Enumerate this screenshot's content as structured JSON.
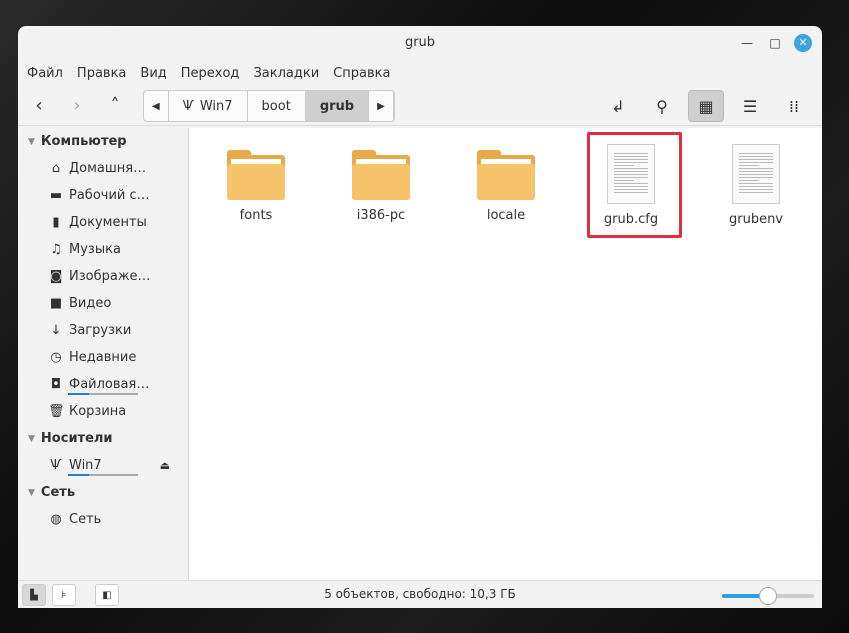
{
  "window": {
    "title": "grub"
  },
  "menu": [
    "Файл",
    "Правка",
    "Вид",
    "Переход",
    "Закладки",
    "Справка"
  ],
  "breadcrumb": [
    "Win7",
    "boot",
    "grub"
  ],
  "sidebar": {
    "sections": [
      {
        "title": "Компьютер",
        "items": [
          {
            "label": "Домашня…",
            "icon": "home-icon",
            "glyph": "⌂"
          },
          {
            "label": "Рабочий с…",
            "icon": "desktop-icon",
            "glyph": "▬"
          },
          {
            "label": "Документы",
            "icon": "document-icon",
            "glyph": "▮"
          },
          {
            "label": "Музыка",
            "icon": "music-icon",
            "glyph": "♫"
          },
          {
            "label": "Изображе…",
            "icon": "camera-icon",
            "glyph": "◙"
          },
          {
            "label": "Видео",
            "icon": "video-folder-icon",
            "glyph": "■"
          },
          {
            "label": "Загрузки",
            "icon": "download-icon",
            "glyph": "↓"
          },
          {
            "label": "Недавние",
            "icon": "clock-icon",
            "glyph": "◷"
          },
          {
            "label": "Файловая…",
            "icon": "filesystem-icon",
            "glyph": "◘",
            "usage": 0.3
          },
          {
            "label": "Корзина",
            "icon": "trash-icon",
            "glyph": "🗑"
          }
        ]
      },
      {
        "title": "Носители",
        "items": [
          {
            "label": "Win7",
            "icon": "usb-icon",
            "glyph": "Ѱ",
            "usage": 0.3,
            "eject": "⏏"
          }
        ]
      },
      {
        "title": "Сеть",
        "items": [
          {
            "label": "Сеть",
            "icon": "network-icon",
            "glyph": "◍"
          }
        ]
      }
    ]
  },
  "files": [
    {
      "name": "fonts",
      "type": "folder"
    },
    {
      "name": "i386-pc",
      "type": "folder"
    },
    {
      "name": "locale",
      "type": "folder"
    },
    {
      "name": "grub.cfg",
      "type": "text",
      "selected": true
    },
    {
      "name": "grubenv",
      "type": "text"
    }
  ],
  "status": {
    "text": "5 объектов, свободно: 10,3 ГБ",
    "zoom": 0.45
  }
}
